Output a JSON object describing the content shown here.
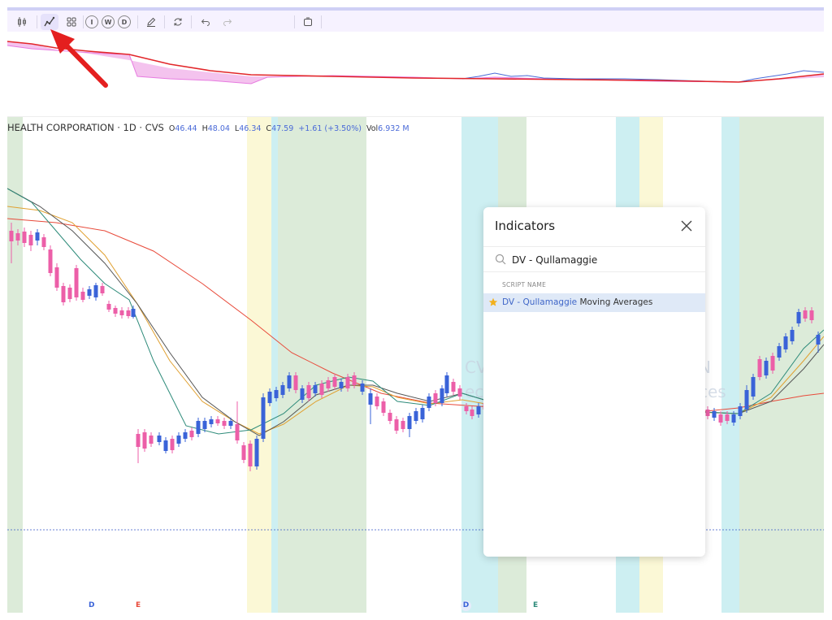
{
  "toolbar": {
    "items": [
      {
        "name": "candle-type-icon",
        "glyph": "⫼"
      },
      {
        "name": "indicators-icon",
        "glyph": "⌇"
      },
      {
        "name": "layout-grid-icon",
        "glyph": "⊞"
      }
    ],
    "intervals": [
      "I",
      "W",
      "D"
    ]
  },
  "legend": {
    "symbol_name": "HEALTH CORPORATION · 1D · CVS",
    "open_label": "O",
    "open": "46.44",
    "high_label": "H",
    "high": "48.04",
    "low_label": "L",
    "low": "46.34",
    "close_label": "C",
    "close": "47.59",
    "change": "+1.61 (+3.50%)",
    "volume_label": "Vol",
    "volume": "6.932 M"
  },
  "markers": {
    "d1": "D",
    "e1": "E",
    "d2": "D",
    "e2": "E"
  },
  "watermark": {
    "line1_left": "CV",
    "line1_right": "N",
    "line2_left": "ec",
    "line2_right": "ces"
  },
  "dialog": {
    "title": "Indicators",
    "search_value": "DV - Qullamaggie",
    "column_header": "SCRIPT NAME",
    "result_highlight": "DV - Qullamaggie",
    "result_rest": " Moving Averages"
  },
  "colors": {
    "up_candle": "#3a63d8",
    "down_candle": "#ec5fa8",
    "band_green": "#dcebd9",
    "band_cyan": "#cdeff2",
    "band_yellow": "#fbf8d6",
    "ma_red": "#e84a3a",
    "ma_teal": "#2e8b7a",
    "ma_orange": "#e0a030",
    "ma_gray": "#555555",
    "arrow": "#e41f1f"
  }
}
